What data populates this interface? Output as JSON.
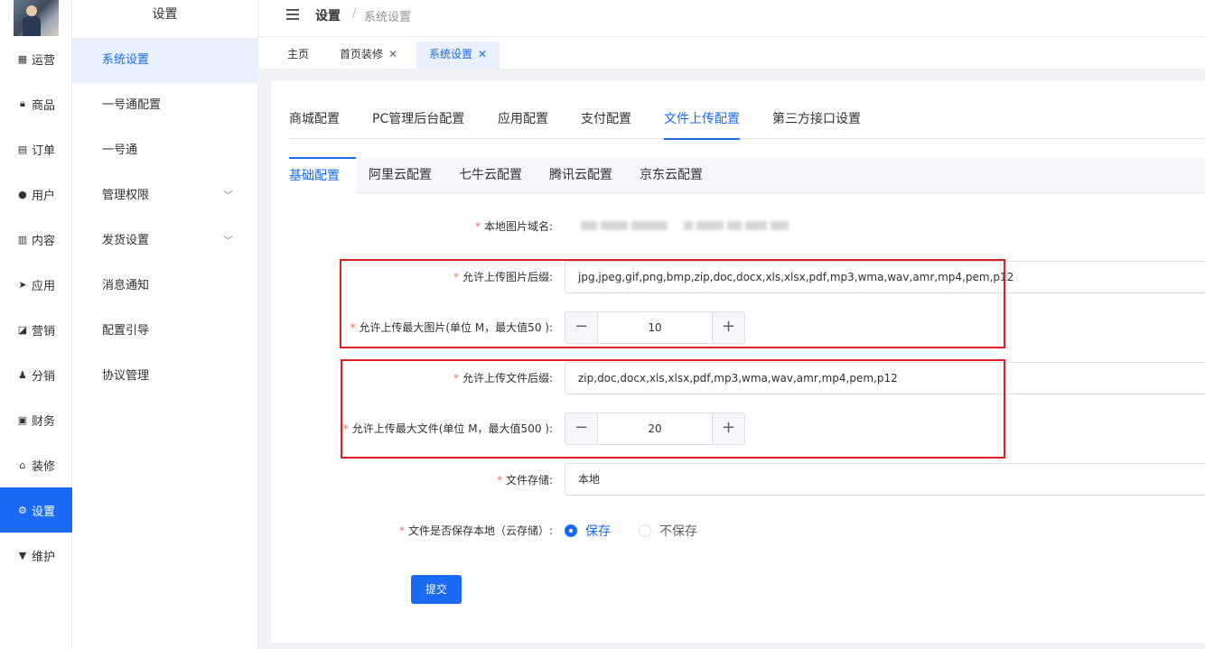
{
  "rail": {
    "items": [
      {
        "label": "运营",
        "icon": "grid-icon"
      },
      {
        "label": "商品",
        "icon": "lock-icon"
      },
      {
        "label": "订单",
        "icon": "document-icon"
      },
      {
        "label": "用户",
        "icon": "user-icon"
      },
      {
        "label": "内容",
        "icon": "book-icon"
      },
      {
        "label": "应用",
        "icon": "send-icon"
      },
      {
        "label": "营销",
        "icon": "chart-icon"
      },
      {
        "label": "分销",
        "icon": "person-icon"
      },
      {
        "label": "财务",
        "icon": "wallet-icon"
      },
      {
        "label": "装修",
        "icon": "home-icon"
      },
      {
        "label": "设置",
        "icon": "gear-icon"
      },
      {
        "label": "维护",
        "icon": "pin-icon"
      }
    ],
    "active_index": 10
  },
  "submenu": {
    "title": "设置",
    "items": [
      {
        "label": "系统设置"
      },
      {
        "label": "一号通配置"
      },
      {
        "label": "一号通"
      },
      {
        "label": "管理权限"
      },
      {
        "label": "发货设置"
      },
      {
        "label": "消息通知"
      },
      {
        "label": "配置引导"
      },
      {
        "label": "协议管理"
      }
    ]
  },
  "header": {
    "crumb_parent": "设置",
    "crumb_separator": "/",
    "crumb_current": "系统设置"
  },
  "page_tabs": [
    {
      "label": "主页",
      "closable": false
    },
    {
      "label": "首页装修",
      "closable": true
    },
    {
      "label": "系统设置",
      "closable": true
    }
  ],
  "close_glyph": "✕",
  "config_tabs": [
    "商城配置",
    "PC管理后台配置",
    "应用配置",
    "支付配置",
    "文件上传配置",
    "第三方接口设置"
  ],
  "config_tab_active": "文件上传配置",
  "sub_tabs": [
    "基础配置",
    "阿里云配置",
    "七牛云配置",
    "腾讯云配置",
    "京东云配置"
  ],
  "sub_tab_active": "基础配置",
  "form": {
    "local_domain_label": "本地图片域名:",
    "image_ext_label": "允许上传图片后缀:",
    "image_ext_value": "jpg,jpeg,gif,png,bmp,zip,doc,docx,xls,xlsx,pdf,mp3,wma,wav,amr,mp4,pem,p12",
    "image_max_label": "允许上传最大图片(单位 M，最大值50 ):",
    "image_max_value": "10",
    "file_ext_label": "允许上传文件后缀:",
    "file_ext_value": "zip,doc,docx,xls,xlsx,pdf,mp3,wma,wav,amr,mp4,pem,p12",
    "file_max_label": "允许上传最大文件(单位 M，最大值500 ):",
    "file_max_value": "20",
    "storage_label": "文件存储:",
    "storage_value": "本地",
    "save_local_label": "文件是否保存本地（云存储）:",
    "save_option": "保存",
    "nosave_option": "不保存",
    "submit_label": "提交",
    "required_mark": "*",
    "minus_glyph": "−",
    "plus_glyph": "+"
  },
  "colors": {
    "accent": "#1a6af5",
    "highlight_box": "#e02020"
  }
}
